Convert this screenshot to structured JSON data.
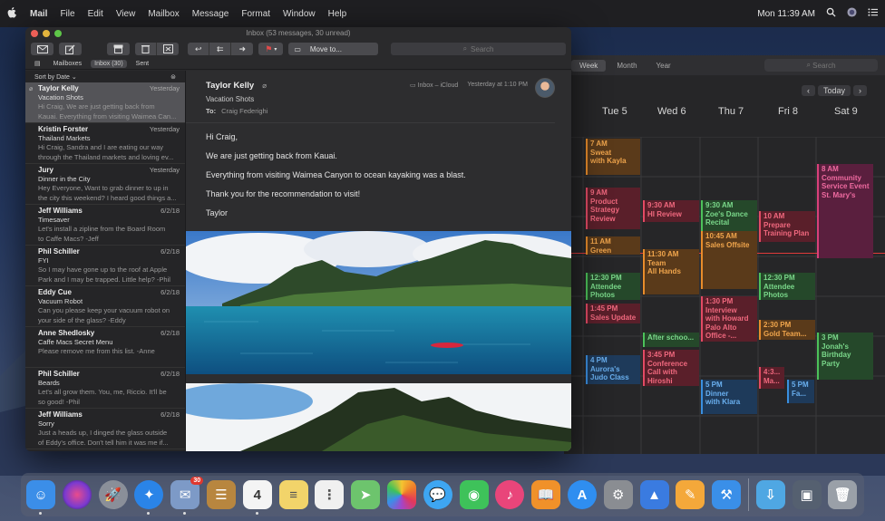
{
  "menubar": {
    "apple": "",
    "items": [
      "Mail",
      "File",
      "Edit",
      "View",
      "Mailbox",
      "Message",
      "Format",
      "Window",
      "Help"
    ],
    "clock": "Mon 11:39 AM"
  },
  "mail": {
    "title": "Inbox (53 messages, 30 unread)",
    "toolbar": {
      "move_label": "Move to...",
      "search_placeholder": "Search"
    },
    "favorites": [
      "Mailboxes",
      "Inbox (30)",
      "Sent"
    ],
    "sort_label": "Sort by Date ⌄",
    "messages": [
      {
        "from": "Taylor Kelly",
        "date": "Yesterday",
        "subject": "Vacation Shots",
        "preview1": "Hi Craig, We are just getting back from",
        "preview2": "Kauai. Everything from visiting Waimea Can..."
      },
      {
        "from": "Kristin Forster",
        "date": "Yesterday",
        "subject": "Thailand Markets",
        "preview1": "Hi Craig, Sandra and I are eating our way",
        "preview2": "through the Thailand markets and loving ev..."
      },
      {
        "from": "Jury",
        "date": "Yesterday",
        "subject": "Dinner in the City",
        "preview1": "Hey Everyone, Want to grab dinner to up in",
        "preview2": "the city this weekend? I heard good things a..."
      },
      {
        "from": "Jeff Williams",
        "date": "6/2/18",
        "subject": "Timesaver",
        "preview1": "Let's install a zipline from the Board Room",
        "preview2": "to Caffe Macs? -Jeff"
      },
      {
        "from": "Phil Schiller",
        "date": "6/2/18",
        "subject": "FYI",
        "preview1": "So I may have gone up to the roof at Apple",
        "preview2": "Park and I may be trapped. Little help? -Phil"
      },
      {
        "from": "Eddy Cue",
        "date": "6/2/18",
        "subject": "Vacuum Robot",
        "preview1": "Can you please keep your vacuum robot on",
        "preview2": "your side of the glass? -Eddy"
      },
      {
        "from": "Anne Shedlosky",
        "date": "6/2/18",
        "subject": "Caffe Macs Secret Menu",
        "preview1": "Please remove me from this list. -Anne",
        "preview2": ""
      },
      {
        "from": "Phil Schiller",
        "date": "6/2/18",
        "subject": "Beards",
        "preview1": "Let's all grow them. You, me, Riccio. It'll be",
        "preview2": "so good! -Phil"
      },
      {
        "from": "Jeff Williams",
        "date": "6/2/18",
        "subject": "Sorry",
        "preview1": "Just a heads up, I dinged the glass outside",
        "preview2": "of Eddy's office. Don't tell him it was me if..."
      }
    ],
    "reader": {
      "from": "Taylor Kelly",
      "subject": "Vacation Shots",
      "to_label": "To:",
      "to": "Craig Federighi",
      "mailbox": "Inbox – iCloud",
      "date": "Yesterday at 1:10 PM",
      "body": [
        "Hi Craig,",
        "We are just getting back from Kauai.",
        "Everything from visiting Waimea Canyon to ocean kayaking was a blast.",
        "Thank you for the recommendation to visit!",
        "Taylor"
      ]
    }
  },
  "calendar": {
    "segments": [
      "Week",
      "Month",
      "Year"
    ],
    "search_placeholder": "Search",
    "today_label": "Today",
    "days": [
      "Tue 5",
      "Wed 6",
      "Thu 7",
      "Fri 8",
      "Sat 9"
    ],
    "events": [
      {
        "text": "7 AM\nSweat\nwith Kayla",
        "color": "orange"
      },
      {
        "text": "9 AM\nProduct\nStrategy\nReview",
        "color": "red"
      },
      {
        "text": "9:30 AM\nHI Review",
        "color": "red"
      },
      {
        "text": "9:30 AM\nZoe's Dance\nRecital",
        "color": "green"
      },
      {
        "text": "10 AM\nPrepare\nTraining Plan",
        "color": "red"
      },
      {
        "text": "8 AM\nCommunity\nService Event\nSt. Mary's",
        "color": "pink"
      },
      {
        "text": "11 AM\nGreen Team...",
        "color": "orange"
      },
      {
        "text": "10:45 AM\nSales Offsite",
        "color": "orange"
      },
      {
        "text": "11:30 AM\nTeam\nAll Hands",
        "color": "orange"
      },
      {
        "text": "12:30 PM\nAttendee\nPhotos",
        "color": "green"
      },
      {
        "text": "12:30 PM\nAttendee\nPhotos",
        "color": "green"
      },
      {
        "text": "1:30 PM\nInterview\nwith Howard\nPalo Alto\nOffice -...",
        "color": "red"
      },
      {
        "text": "1:45 PM\nSales Update",
        "color": "red"
      },
      {
        "text": "2:30 PM\nGold Team...",
        "color": "orange"
      },
      {
        "text": "3 PM\nJonah's\nBirthday\nParty",
        "color": "green"
      },
      {
        "text": "After schoo...",
        "color": "green"
      },
      {
        "text": "3:45 PM\nConference\nCall with\nHiroshi",
        "color": "red"
      },
      {
        "text": "4 PM\nAurora's\nJudo Class",
        "color": "blue"
      },
      {
        "text": "4:3...\nMa...",
        "color": "red"
      },
      {
        "text": "5 PM\nDinner\nwith Klara",
        "color": "blue"
      },
      {
        "text": "5 PM\nFa...",
        "color": "blue"
      }
    ]
  },
  "dock": {
    "apps": [
      {
        "name": "finder-icon",
        "color": "#3b8ee8"
      },
      {
        "name": "siri-icon",
        "color": "#7a3ad0"
      },
      {
        "name": "launchpad-icon",
        "color": "#8a8f99"
      },
      {
        "name": "safari-icon",
        "color": "#2a84e8"
      },
      {
        "name": "mail-stamp-icon",
        "color": "#7d9ac7",
        "badge": "30"
      },
      {
        "name": "contacts-icon",
        "color": "#b8863f"
      },
      {
        "name": "calendar-icon",
        "color": "#f4f4f4",
        "label": "4"
      },
      {
        "name": "notes-icon",
        "color": "#f2d46a"
      },
      {
        "name": "reminders-icon",
        "color": "#f0f0f0"
      },
      {
        "name": "maps-icon",
        "color": "#6dc46d"
      },
      {
        "name": "photos-icon",
        "color": "#f4f4f4"
      },
      {
        "name": "messages-icon",
        "color": "#3ea6f2"
      },
      {
        "name": "facetime-icon",
        "color": "#3ec25a"
      },
      {
        "name": "itunes-icon",
        "color": "#e9457a"
      },
      {
        "name": "books-icon",
        "color": "#f0912a"
      },
      {
        "name": "app-store-icon",
        "color": "#2f8ef0"
      },
      {
        "name": "system-preferences-icon",
        "color": "#8a8d92"
      },
      {
        "name": "keynote-icon",
        "color": "#3a7be0"
      },
      {
        "name": "pages-icon",
        "color": "#f4a83a"
      },
      {
        "name": "xcode-icon",
        "color": "#3a8fe8"
      },
      {
        "name": "downloads-folder-icon",
        "color": "#4fa7e3"
      },
      {
        "name": "photos-stack-icon",
        "color": "#556070"
      },
      {
        "name": "trash-icon",
        "color": "#9aa0a8"
      }
    ]
  }
}
